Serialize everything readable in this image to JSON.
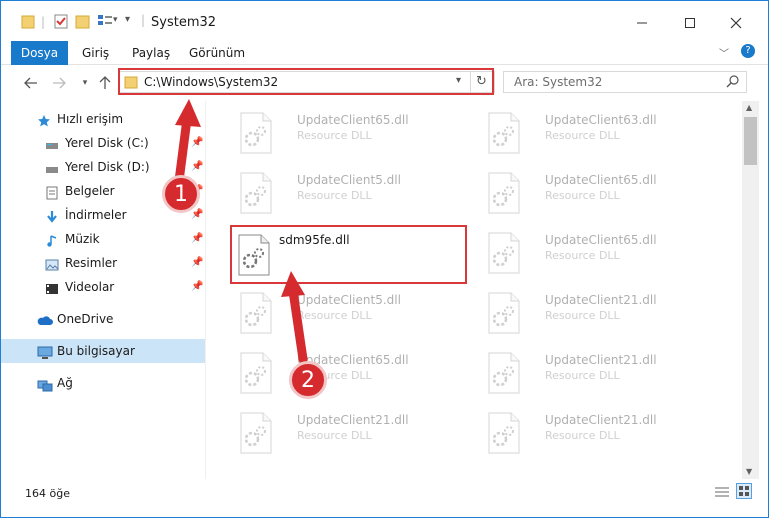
{
  "window": {
    "title": "System32"
  },
  "ribbon": {
    "tabs": [
      "Dosya",
      "Giriş",
      "Paylaş",
      "Görünüm"
    ]
  },
  "address": {
    "path": "C:\\Windows\\System32"
  },
  "search": {
    "placeholder": "Ara: System32"
  },
  "sidebar": {
    "quick_access": "Hızlı erişim",
    "items": [
      {
        "label": "Yerel Disk (C:)",
        "icon": "drive-icon"
      },
      {
        "label": "Yerel Disk (D:)",
        "icon": "drive-icon"
      },
      {
        "label": "Belgeler",
        "icon": "documents-icon"
      },
      {
        "label": "İndirmeler",
        "icon": "downloads-icon"
      },
      {
        "label": "Müzik",
        "icon": "music-icon"
      },
      {
        "label": "Resimler",
        "icon": "pictures-icon"
      },
      {
        "label": "Videolar",
        "icon": "videos-icon"
      }
    ],
    "onedrive": "OneDrive",
    "this_pc": "Bu bilgisayar",
    "network": "Ağ"
  },
  "files": {
    "selected": {
      "name": "sdm95fe.dll"
    },
    "left_column": [
      {
        "name": "UpdateClient65.dll",
        "desc": "Resource DLL"
      },
      {
        "name": "UpdateClient5.dll",
        "desc": "Resource DLL"
      },
      {
        "name": "UpdateClient5.dll",
        "desc": "Resource DLL"
      },
      {
        "name": "UpdateClient65.dll",
        "desc": "Resource DLL"
      },
      {
        "name": "UpdateClient21.dll",
        "desc": "Resource DLL"
      }
    ],
    "right_column": [
      {
        "name": "UpdateClient63.dll",
        "desc": "Resource DLL"
      },
      {
        "name": "UpdateClient65.dll",
        "desc": "Resource DLL"
      },
      {
        "name": "UpdateClient65.dll",
        "desc": "Resource DLL"
      },
      {
        "name": "UpdateClient21.dll",
        "desc": "Resource DLL"
      },
      {
        "name": "UpdateClient21.dll",
        "desc": "Resource DLL"
      },
      {
        "name": "UpdateClient21.dll",
        "desc": "Resource DLL"
      }
    ]
  },
  "status": {
    "count": "164 öğe"
  },
  "annotations": {
    "badge1": "1",
    "badge2": "2"
  },
  "colors": {
    "accent": "#1979ca",
    "highlight": "#d9383a"
  }
}
